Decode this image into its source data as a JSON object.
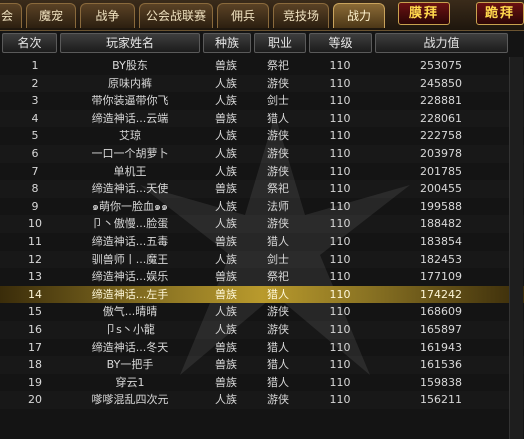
{
  "tabs": [
    {
      "label": "会"
    },
    {
      "label": "魔宠"
    },
    {
      "label": "战争"
    },
    {
      "label": "公会战联赛"
    },
    {
      "label": "佣兵"
    },
    {
      "label": "竞技场"
    },
    {
      "label": "战力",
      "active": true
    }
  ],
  "actions": {
    "worship": "膜拜",
    "kneel": "跪拜"
  },
  "columns": {
    "rank": "名次",
    "name": "玩家姓名",
    "race": "种族",
    "job": "职业",
    "level": "等级",
    "power": "战力值"
  },
  "rows": [
    {
      "rank": "1",
      "name": "BY股东",
      "race": "兽族",
      "job": "祭祀",
      "level": "110",
      "power": "253075"
    },
    {
      "rank": "2",
      "name": "原味内裤",
      "race": "人族",
      "job": "游侠",
      "level": "110",
      "power": "245850"
    },
    {
      "rank": "3",
      "name": "带你装逼带你飞",
      "race": "人族",
      "job": "剑士",
      "level": "110",
      "power": "228881"
    },
    {
      "rank": "4",
      "name": "缔造神话...云端",
      "race": "兽族",
      "job": "猎人",
      "level": "110",
      "power": "228061"
    },
    {
      "rank": "5",
      "name": "艾琼",
      "race": "人族",
      "job": "游侠",
      "level": "110",
      "power": "222758"
    },
    {
      "rank": "6",
      "name": "一口一个胡萝卜",
      "race": "人族",
      "job": "游侠",
      "level": "110",
      "power": "203978"
    },
    {
      "rank": "7",
      "name": "单机王",
      "race": "人族",
      "job": "游侠",
      "level": "110",
      "power": "201785"
    },
    {
      "rank": "8",
      "name": "缔造神话...天使",
      "race": "兽族",
      "job": "祭祀",
      "level": "110",
      "power": "200455"
    },
    {
      "rank": "9",
      "name": "๑萌你一脸血๑๑",
      "race": "人族",
      "job": "法师",
      "level": "110",
      "power": "199588"
    },
    {
      "rank": "10",
      "name": "卩丶傲慢...脸蛋",
      "race": "人族",
      "job": "游侠",
      "level": "110",
      "power": "188482"
    },
    {
      "rank": "11",
      "name": "缔造神话...五毒",
      "race": "兽族",
      "job": "猎人",
      "level": "110",
      "power": "183854"
    },
    {
      "rank": "12",
      "name": "驯兽师丨...魔王",
      "race": "人族",
      "job": "剑士",
      "level": "110",
      "power": "182453"
    },
    {
      "rank": "13",
      "name": "缔造神话...娱乐",
      "race": "兽族",
      "job": "祭祀",
      "level": "110",
      "power": "177109"
    },
    {
      "rank": "14",
      "name": "缔造神话...左手",
      "race": "兽族",
      "job": "猎人",
      "level": "110",
      "power": "174242",
      "selected": true
    },
    {
      "rank": "15",
      "name": "傲气...晴晴",
      "race": "人族",
      "job": "游侠",
      "level": "110",
      "power": "168609"
    },
    {
      "rank": "16",
      "name": "卩s丶小龍",
      "race": "人族",
      "job": "游侠",
      "level": "110",
      "power": "165897"
    },
    {
      "rank": "17",
      "name": "缔造神话...冬天",
      "race": "兽族",
      "job": "猎人",
      "level": "110",
      "power": "161943"
    },
    {
      "rank": "18",
      "name": "BY一把手",
      "race": "兽族",
      "job": "猎人",
      "level": "110",
      "power": "161536"
    },
    {
      "rank": "19",
      "name": "穿云1",
      "race": "兽族",
      "job": "猎人",
      "level": "110",
      "power": "159838"
    },
    {
      "rank": "20",
      "name": "嗲嗲混乱四次元",
      "race": "人族",
      "job": "游侠",
      "level": "110",
      "power": "156211"
    }
  ]
}
